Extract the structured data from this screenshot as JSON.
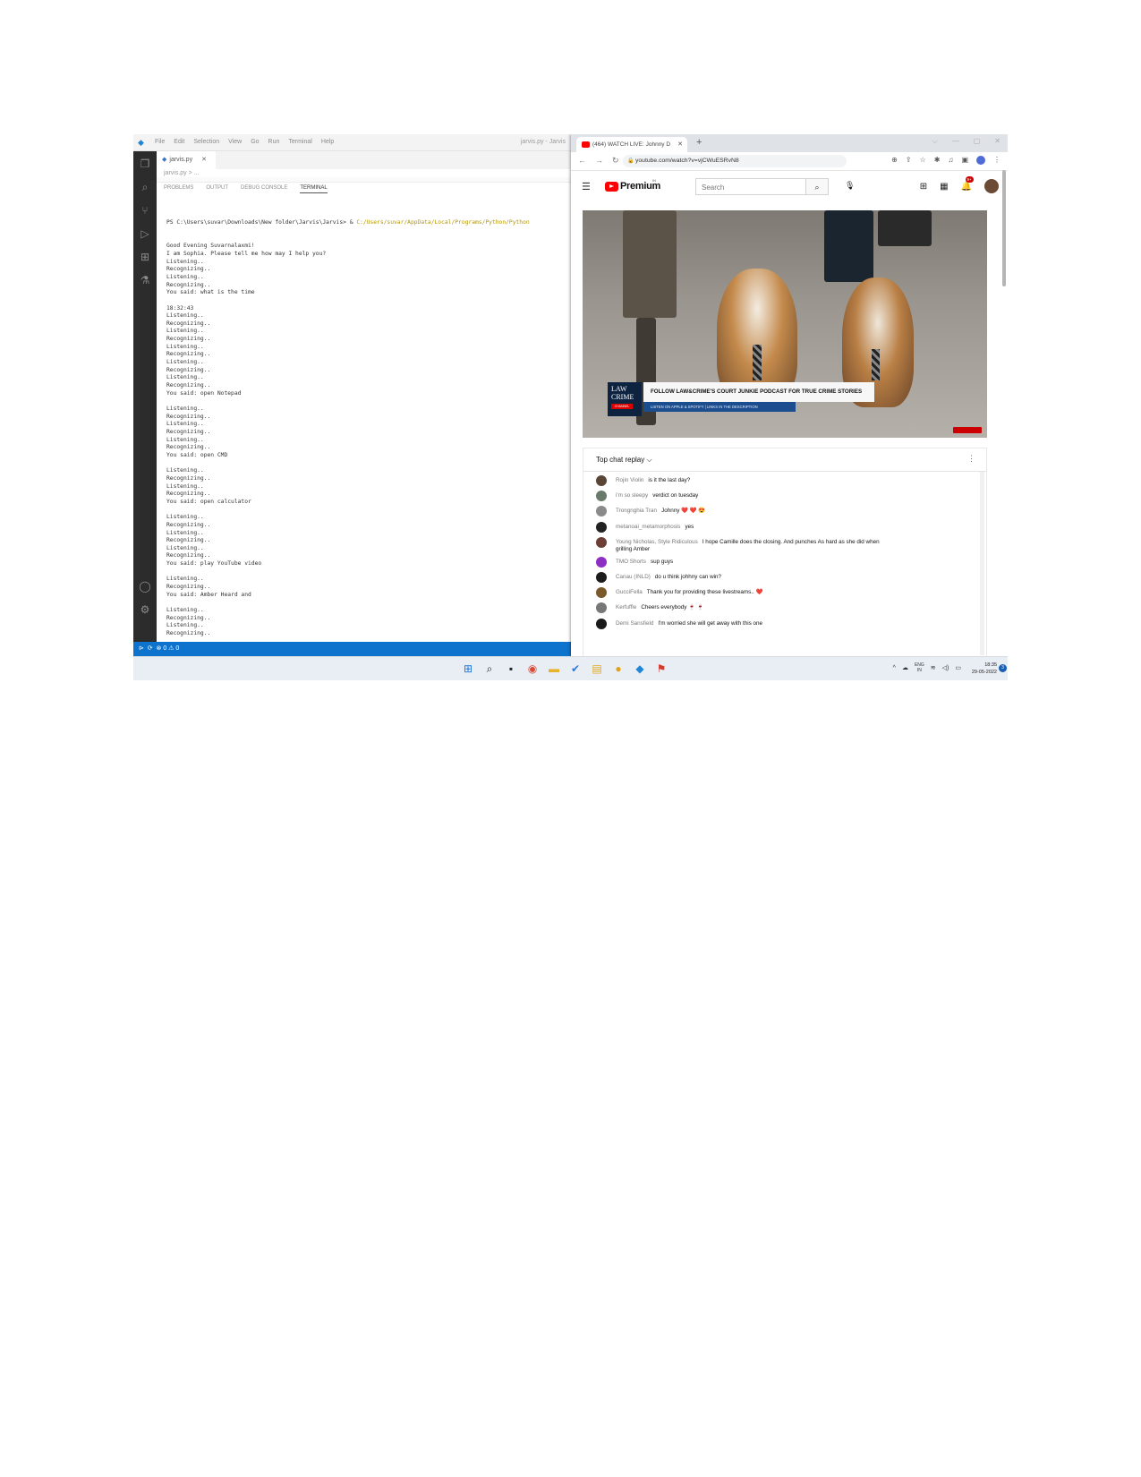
{
  "vscode": {
    "window_title": "jarvis.py - Jarvis",
    "menu": [
      "File",
      "Edit",
      "Selection",
      "View",
      "Go",
      "Run",
      "Terminal",
      "Help"
    ],
    "tab_label": "jarvis.py",
    "breadcrumb": "jarvis.py > ...",
    "panel_tabs": [
      "PROBLEMS",
      "OUTPUT",
      "DEBUG CONSOLE",
      "TERMINAL"
    ],
    "terminal": {
      "prompt": "PS C:\\Users\\suvar\\Downloads\\New folder\\Jarvis\\Jarvis> & ",
      "python_path": "C:/Users/suvar/AppData/Local/Programs/Python/Python",
      "lines": [
        "Good Evening Suvarnalaxmi!",
        "I am Sophia. Please tell me how may I help you?",
        "Listening..",
        "Recognizing..",
        "Listening..",
        "Recognizing..",
        "You said: what is the time",
        "",
        "18:32:43",
        "Listening..",
        "Recognizing..",
        "Listening..",
        "Recognizing..",
        "Listening..",
        "Recognizing..",
        "Listening..",
        "Recognizing..",
        "Listening..",
        "Recognizing..",
        "You said: open Notepad",
        "",
        "Listening..",
        "Recognizing..",
        "Listening..",
        "Recognizing..",
        "Listening..",
        "Recognizing..",
        "You said: open CMD",
        "",
        "Listening..",
        "Recognizing..",
        "Listening..",
        "Recognizing..",
        "You said: open calculator",
        "",
        "Listening..",
        "Recognizing..",
        "Listening..",
        "Recognizing..",
        "Listening..",
        "Recognizing..",
        "You said: play YouTube video",
        "",
        "Listening..",
        "Recognizing..",
        "You said: Amber Heard and",
        "",
        "Listening..",
        "Recognizing..",
        "Listening..",
        "Recognizing.."
      ]
    },
    "status_left": "⊗ 0 ⚠ 0"
  },
  "chrome": {
    "tab_title": "(464) WATCH LIVE: Johnny D",
    "url": "youtube.com/watch?v=vjCWuESRvN8",
    "icons": [
      "back-icon",
      "forward-icon",
      "reload-icon",
      "lock-icon",
      "extensions-icon",
      "profile-icon"
    ]
  },
  "youtube": {
    "brand": "Premium",
    "country_code": "IN",
    "search_placeholder": "Search",
    "notification_count": "9+",
    "video": {
      "logo_line1": "LAW",
      "logo_line2": "CRIME",
      "logo_badge": "CHANNEL",
      "headline": "FOLLOW LAW&CRIME'S COURT JUNKIE PODCAST FOR TRUE CRIME STORIES",
      "subline": "LISTEN ON APPLE & SPOTIFY | LINKS IN THE DESCRIPTION"
    },
    "chat": {
      "title": "Top chat replay ⌵",
      "messages": [
        {
          "author": "Rojin Violin",
          "text": "is it the last day?",
          "avatar_color": "#5a4636"
        },
        {
          "author": "i'm so sleepy",
          "text": "verdict on tuesday",
          "avatar_color": "#6a7a6a"
        },
        {
          "author": "Trongnghia Tran",
          "text": "Johnny ❤️ ❤️ 😍",
          "avatar_color": "#8a8a8a"
        },
        {
          "author": "metanoai_metamorphosis",
          "text": "yes",
          "avatar_color": "#222222"
        },
        {
          "author": "Young Nicholas, Style Ridiculous",
          "text": "I hope Camille does the closing. And punches As hard as she did when",
          "text2": "grilling Amber",
          "avatar_color": "#6b3f35"
        },
        {
          "author": "TMO Shorts",
          "text": "sup guys",
          "avatar_color": "#8e2fc4"
        },
        {
          "author": "Canau (INLD)",
          "text": "do u think johhny can win?",
          "avatar_color": "#1c1c1c"
        },
        {
          "author": "GucciFella",
          "text": "Thank you for providing these livestreams.. ❤️",
          "avatar_color": "#7a5a2a"
        },
        {
          "author": "Kerfuffle",
          "text": "Cheers everybody 🍷 🍷",
          "avatar_color": "#777777"
        },
        {
          "author": "Demi Sansfield",
          "text": "I'm worried she will get away with this one",
          "avatar_color": "#1a1a1a"
        }
      ]
    }
  },
  "taskbar": {
    "apps": [
      "windows-start-icon",
      "search-icon",
      "task-view-icon",
      "chrome-icon",
      "file-explorer-icon",
      "todo-icon",
      "notes-icon",
      "app-icon",
      "vscode-icon",
      "python-icon"
    ],
    "lang_line1": "ENG",
    "lang_line2": "IN",
    "time": "18:35",
    "date": "29-05-2022",
    "notification_count": "3"
  }
}
